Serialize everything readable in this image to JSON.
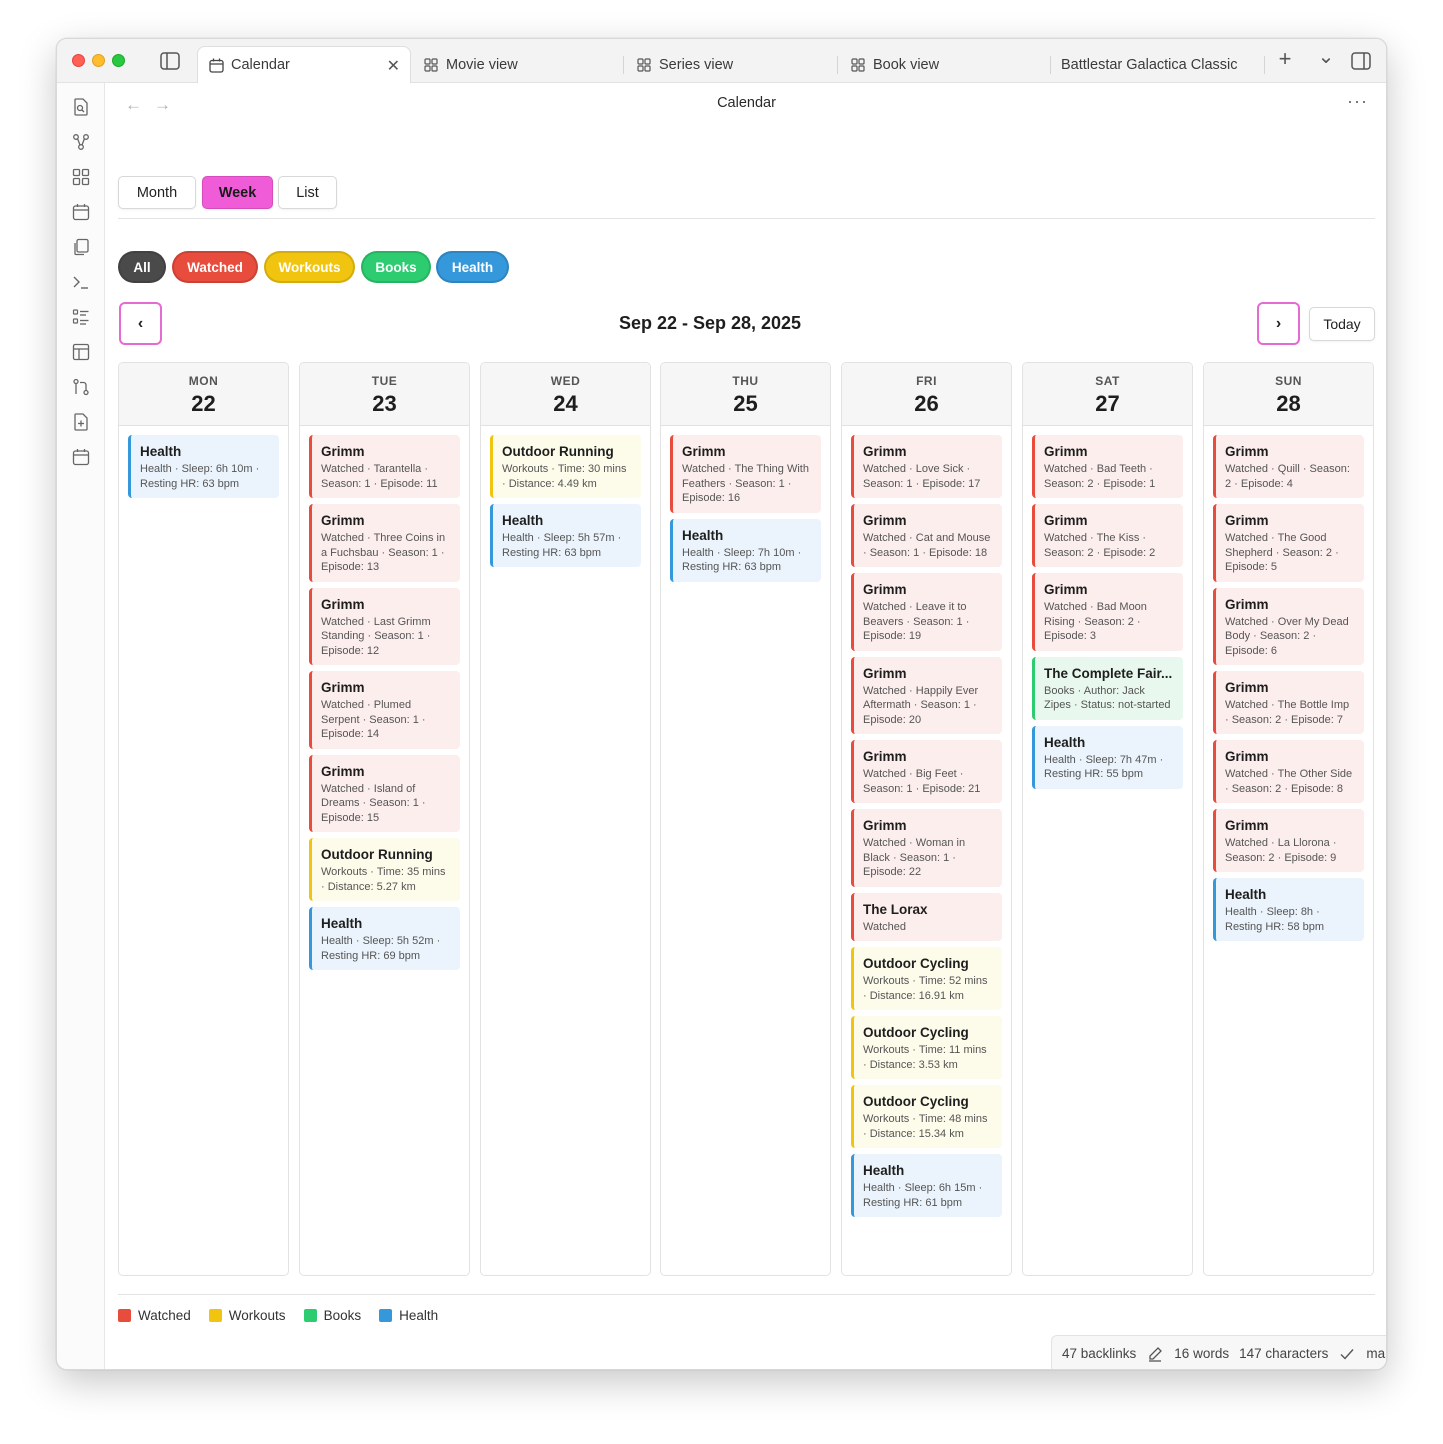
{
  "tabs": [
    {
      "label": "Calendar",
      "icon": "calendar-icon",
      "active": true
    },
    {
      "label": "Movie view",
      "icon": "grid-icon"
    },
    {
      "label": "Series view",
      "icon": "grid-icon"
    },
    {
      "label": "Book view",
      "icon": "grid-icon"
    },
    {
      "label": "Battlestar Galactica Classic"
    }
  ],
  "header": {
    "title": "Calendar",
    "more": "···",
    "back": "←",
    "forward": "→",
    "close": "✕",
    "new_tab": "+",
    "tab_list": "⌄"
  },
  "views": [
    "Month",
    "Week",
    "List"
  ],
  "active_view": "Week",
  "filters": [
    {
      "label": "All",
      "color": "#4a4a4a"
    },
    {
      "label": "Watched",
      "color": "#e74c3c"
    },
    {
      "label": "Workouts",
      "color": "#f1c40f"
    },
    {
      "label": "Books",
      "color": "#2ecc71"
    },
    {
      "label": "Health",
      "color": "#3498db"
    }
  ],
  "navigation": {
    "prev": "‹",
    "next": "›",
    "today": "Today",
    "range": "Sep 22 - Sep 28, 2025"
  },
  "days": [
    {
      "name": "MON",
      "num": "22",
      "events": [
        {
          "type": "health",
          "title": "Health",
          "detail": "Health · Sleep: 6h 10m · Resting HR: 63 bpm"
        }
      ]
    },
    {
      "name": "TUE",
      "num": "23",
      "events": [
        {
          "type": "watched",
          "title": "Grimm",
          "detail": "Watched · Tarantella · Season: 1 · Episode: 11"
        },
        {
          "type": "watched",
          "title": "Grimm",
          "detail": "Watched · Three Coins in a Fuchsbau · Season: 1 · Episode: 13"
        },
        {
          "type": "watched",
          "title": "Grimm",
          "detail": "Watched · Last Grimm Standing · Season: 1 · Episode: 12"
        },
        {
          "type": "watched",
          "title": "Grimm",
          "detail": "Watched · Plumed Serpent · Season: 1 · Episode: 14"
        },
        {
          "type": "watched",
          "title": "Grimm",
          "detail": "Watched · Island of Dreams · Season: 1 · Episode: 15"
        },
        {
          "type": "workouts",
          "title": "Outdoor Running",
          "detail": "Workouts · Time: 35 mins · Distance: 5.27 km"
        },
        {
          "type": "health",
          "title": "Health",
          "detail": "Health · Sleep: 5h 52m · Resting HR: 69 bpm"
        }
      ]
    },
    {
      "name": "WED",
      "num": "24",
      "events": [
        {
          "type": "workouts",
          "title": "Outdoor Running",
          "detail": "Workouts · Time: 30 mins · Distance: 4.49 km"
        },
        {
          "type": "health",
          "title": "Health",
          "detail": "Health · Sleep: 5h 57m · Resting HR: 63 bpm"
        }
      ]
    },
    {
      "name": "THU",
      "num": "25",
      "events": [
        {
          "type": "watched",
          "title": "Grimm",
          "detail": "Watched · The Thing With Feathers · Season: 1 · Episode: 16"
        },
        {
          "type": "health",
          "title": "Health",
          "detail": "Health · Sleep: 7h 10m · Resting HR: 63 bpm"
        }
      ]
    },
    {
      "name": "FRI",
      "num": "26",
      "events": [
        {
          "type": "watched",
          "title": "Grimm",
          "detail": "Watched · Love Sick · Season: 1 · Episode: 17"
        },
        {
          "type": "watched",
          "title": "Grimm",
          "detail": "Watched · Cat and Mouse · Season: 1 · Episode: 18"
        },
        {
          "type": "watched",
          "title": "Grimm",
          "detail": "Watched · Leave it to Beavers · Season: 1 · Episode: 19"
        },
        {
          "type": "watched",
          "title": "Grimm",
          "detail": "Watched · Happily Ever Aftermath · Season: 1 · Episode: 20"
        },
        {
          "type": "watched",
          "title": "Grimm",
          "detail": "Watched · Big Feet · Season: 1 · Episode: 21"
        },
        {
          "type": "watched",
          "title": "Grimm",
          "detail": "Watched · Woman in Black · Season: 1 · Episode: 22"
        },
        {
          "type": "watched",
          "title": "The Lorax",
          "detail": "Watched"
        },
        {
          "type": "workouts",
          "title": "Outdoor Cycling",
          "detail": "Workouts · Time: 52 mins · Distance: 16.91 km"
        },
        {
          "type": "workouts",
          "title": "Outdoor Cycling",
          "detail": "Workouts · Time: 11 mins · Distance: 3.53 km"
        },
        {
          "type": "workouts",
          "title": "Outdoor Cycling",
          "detail": "Workouts · Time: 48 mins · Distance: 15.34 km"
        },
        {
          "type": "health",
          "title": "Health",
          "detail": "Health · Sleep: 6h 15m · Resting HR: 61 bpm"
        }
      ]
    },
    {
      "name": "SAT",
      "num": "27",
      "events": [
        {
          "type": "watched",
          "title": "Grimm",
          "detail": "Watched · Bad Teeth · Season: 2 · Episode: 1"
        },
        {
          "type": "watched",
          "title": "Grimm",
          "detail": "Watched · The Kiss · Season: 2 · Episode: 2"
        },
        {
          "type": "watched",
          "title": "Grimm",
          "detail": "Watched · Bad Moon Rising · Season: 2 · Episode: 3"
        },
        {
          "type": "books",
          "title": "The Complete Fair...",
          "detail": "Books · Author: Jack Zipes · Status: not-started"
        },
        {
          "type": "health",
          "title": "Health",
          "detail": "Health · Sleep: 7h 47m · Resting HR: 55 bpm"
        }
      ]
    },
    {
      "name": "SUN",
      "num": "28",
      "events": [
        {
          "type": "watched",
          "title": "Grimm",
          "detail": "Watched · Quill · Season: 2 · Episode: 4"
        },
        {
          "type": "watched",
          "title": "Grimm",
          "detail": "Watched · The Good Shepherd · Season: 2 · Episode: 5"
        },
        {
          "type": "watched",
          "title": "Grimm",
          "detail": "Watched · Over My Dead Body · Season: 2 · Episode: 6"
        },
        {
          "type": "watched",
          "title": "Grimm",
          "detail": "Watched · The Bottle Imp · Season: 2 · Episode: 7"
        },
        {
          "type": "watched",
          "title": "Grimm",
          "detail": "Watched · The Other Side · Season: 2 · Episode: 8"
        },
        {
          "type": "watched",
          "title": "Grimm",
          "detail": "Watched · La Llorona · Season: 2 · Episode: 9"
        },
        {
          "type": "health",
          "title": "Health",
          "detail": "Health · Sleep: 8h · Resting HR: 58 bpm"
        }
      ]
    }
  ],
  "legend": [
    {
      "label": "Watched",
      "color": "#e74c3c"
    },
    {
      "label": "Workouts",
      "color": "#f1c40f"
    },
    {
      "label": "Books",
      "color": "#2ecc71"
    },
    {
      "label": "Health",
      "color": "#3498db"
    }
  ],
  "status": {
    "backlinks": "47 backlinks",
    "words": "16 words",
    "characters": "147 characters",
    "branch": "main"
  }
}
